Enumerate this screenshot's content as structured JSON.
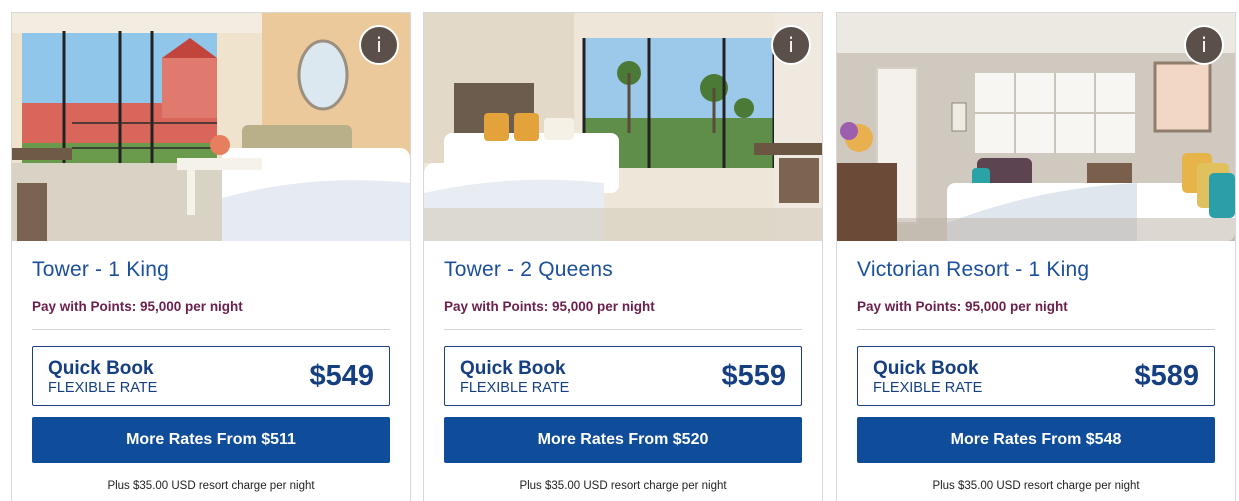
{
  "rooms": [
    {
      "photo_label": "Tower king room with ocean view balcony",
      "info_icon": "i",
      "title": "Tower - 1 King",
      "points": "Pay with Points: 95,000 per night",
      "quick_book": {
        "title": "Quick Book",
        "subtitle": "FLEXIBLE RATE",
        "price": "$549"
      },
      "more_rates": "More Rates From $511",
      "resort_fee": "Plus $35.00 USD resort charge per night"
    },
    {
      "photo_label": "Tower two queen beds room with palm tree view",
      "info_icon": "i",
      "title": "Tower - 2 Queens",
      "points": "Pay with Points: 95,000 per night",
      "quick_book": {
        "title": "Quick Book",
        "subtitle": "FLEXIBLE RATE",
        "price": "$559"
      },
      "more_rates": "More Rates From $520",
      "resort_fee": "Plus $35.00 USD resort charge per night"
    },
    {
      "photo_label": "Victorian resort king room",
      "info_icon": "i",
      "title": "Victorian Resort - 1 King",
      "points": "Pay with Points: 95,000 per night",
      "quick_book": {
        "title": "Quick Book",
        "subtitle": "FLEXIBLE RATE",
        "price": "$589"
      },
      "more_rates": "More Rates From $548",
      "resort_fee": "Plus $35.00 USD resort charge per night"
    }
  ],
  "colors": {
    "title_blue": "#1c4f9c",
    "button_blue": "#0f4c9a",
    "points_maroon": "#6b1f4b",
    "info_button": "#5a5049"
  }
}
